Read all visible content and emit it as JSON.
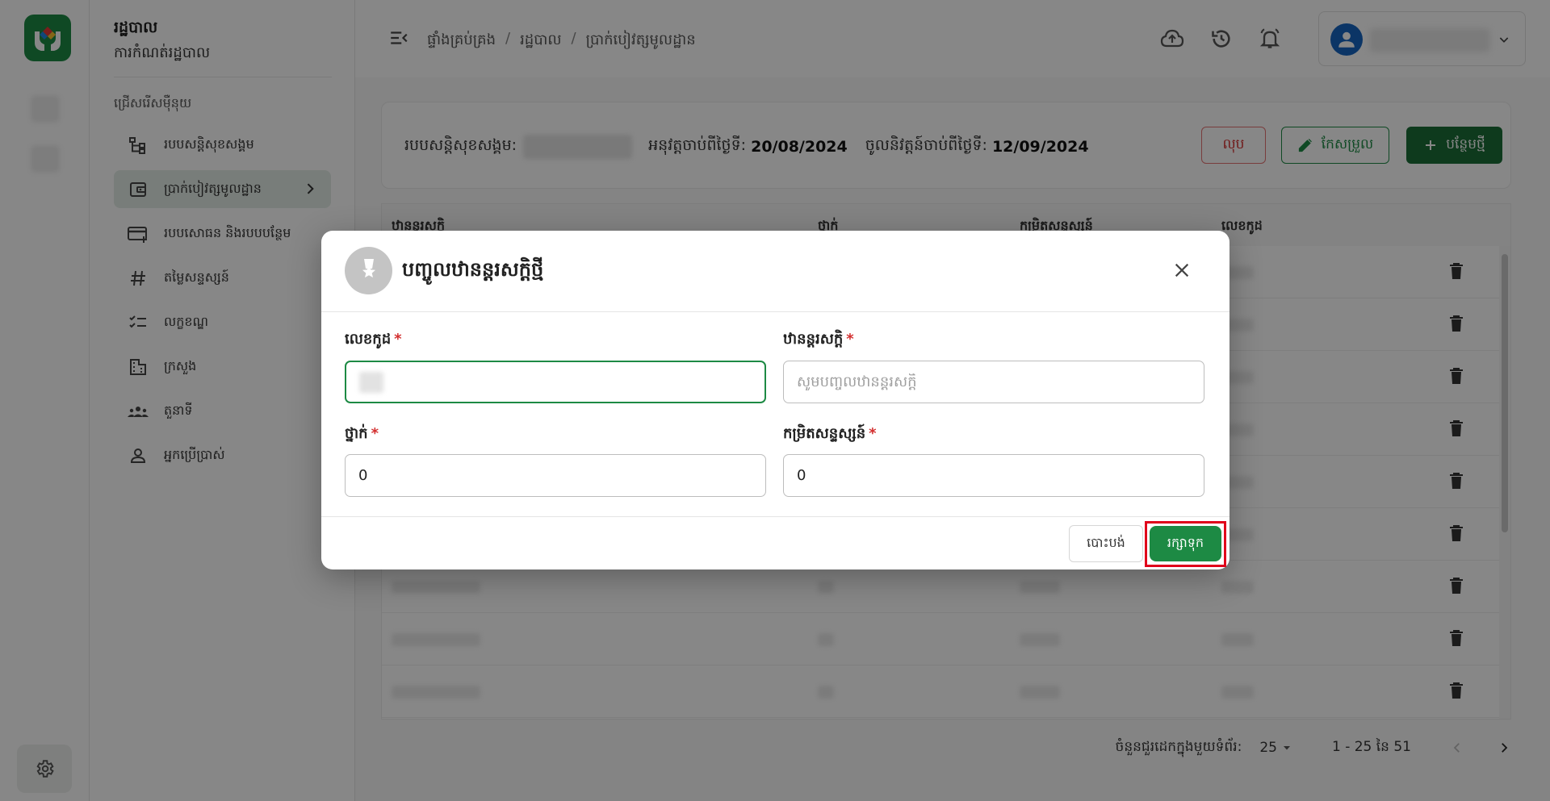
{
  "app": {
    "title": "រដ្ឋបាល",
    "subtitle": "ការកំណត់រដ្ឋបាល"
  },
  "sidebar": {
    "section_label": "ជ្រើសរើសម៉ឺនុយ",
    "items": [
      {
        "label": "របបសន្តិសុខសង្គម",
        "icon": "hierarchy-icon",
        "active": false
      },
      {
        "label": "ប្រាក់បៀវត្សមូលដ្ឋាន",
        "icon": "wallet-icon",
        "active": true
      },
      {
        "label": "របបសោធន និងរបបបន្ថែម",
        "icon": "card-plus-icon",
        "active": false
      },
      {
        "label": "តម្លៃសន្ទស្សន៍",
        "icon": "hash-icon",
        "active": false
      },
      {
        "label": "លក្ខខណ្ឌ",
        "icon": "checklist-icon",
        "active": false
      },
      {
        "label": "ក្រសួង",
        "icon": "building-icon",
        "active": false
      },
      {
        "label": "តួនាទី",
        "icon": "group-icon",
        "active": false
      },
      {
        "label": "អ្នកប្រើប្រាស់",
        "icon": "person-icon",
        "active": false
      }
    ]
  },
  "breadcrumb": [
    "ផ្ទាំងគ្រប់គ្រង",
    "រដ្ឋបាល",
    "ប្រាក់បៀវត្សមូលដ្ឋាន"
  ],
  "info_bar": {
    "scheme_label": "របបសន្តិសុខសង្គម:",
    "approved_label": "អនុវត្តចាប់ពីថ្ងៃទី:",
    "approved_date": "20/08/2024",
    "effective_label": "ចូលនិវត្តន៍ចាប់ពីថ្ងៃទី:",
    "effective_date": "12/09/2024",
    "delete_label": "លុប",
    "edit_label": "កែសម្រួល",
    "add_label": "បន្ថែមថ្មី"
  },
  "table": {
    "headers": [
      "ឋានន្តរសក្តិ",
      "ថ្នាក់",
      "កម្រិតសន្ទស្សន៍",
      "លេខកូដ"
    ]
  },
  "pagination": {
    "rows_per_page_label": "ចំនួនជួរដេកក្នុងមួយទំព័រ:",
    "rows_per_page": "25",
    "range": "1 - 25 នៃ 51"
  },
  "modal": {
    "title": "បញ្ចូលឋានន្តរសក្តិថ្មី",
    "code_label": "លេខកូដ",
    "rank_label": "ឋានន្តរសក្តិ",
    "rank_placeholder": "សូមបញ្ចូលឋានន្តរសក្តិ",
    "grade_label": "ថ្នាក់",
    "grade_value": "0",
    "index_label": "កម្រិតសន្ទស្សន៍",
    "index_value": "0",
    "required_mark": "*",
    "cancel_label": "បោះបង់",
    "save_label": "រក្សាទុក"
  },
  "colors": {
    "primary": "#1d8a44",
    "primary_dark": "#1b6f37",
    "danger": "#d32f2f",
    "highlight": "#e0001b"
  }
}
